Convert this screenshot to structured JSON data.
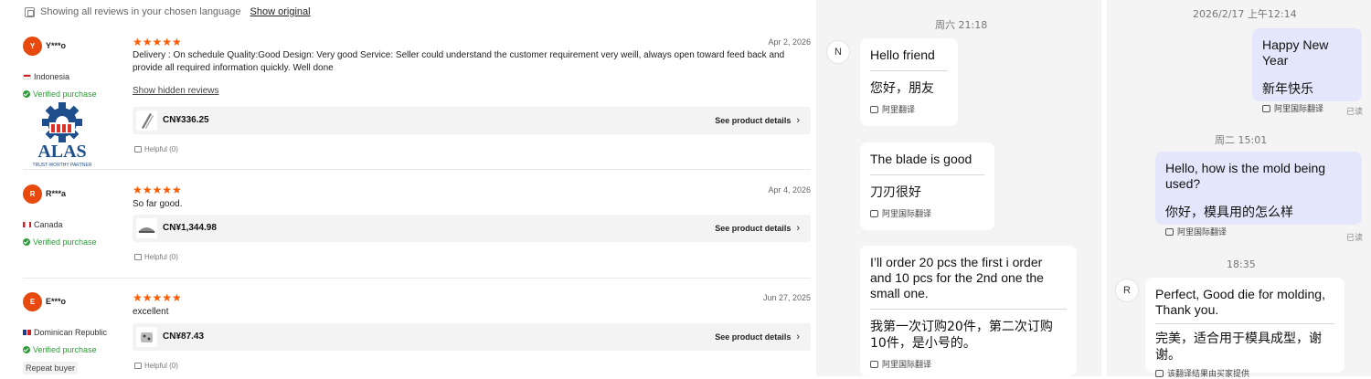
{
  "reviews_panel": {
    "language_note": "Showing all reviews in your chosen language",
    "show_original": "Show original",
    "hidden_reviews_link": "Show hidden reviews",
    "see_details": "See product details",
    "logo": {
      "name": "ALAS",
      "tagline": "TRUST-WORTHY PARTNER"
    },
    "reviews": [
      {
        "initial": "Y",
        "user": "Y***o",
        "country": "Indonesia",
        "verified": "Verified purchase",
        "stars": "★★★★★",
        "date": "Apr 2, 2026",
        "text": "Delivery : On schedule Quality:Good Design: Very good Service: Seller could understand the customer requirement very weill, always open toward feed back and provide all required information quickly. Well done",
        "price": "CN¥336.25",
        "helpful": "Helpful (0)"
      },
      {
        "initial": "R",
        "user": "R***a",
        "country": "Canada",
        "verified": "Verified purchase",
        "stars": "★★★★★",
        "date": "Apr 4, 2026",
        "text": "So far good.",
        "price": "CN¥1,344.98",
        "helpful": "Helpful (0)"
      },
      {
        "initial": "E",
        "user": "E***o",
        "country": "Dominican Republic",
        "verified": "Verified purchase",
        "badge": "Repeat buyer",
        "stars": "★★★★★",
        "date": "Jun 27, 2025",
        "text": "excellent",
        "price": "CN¥87.43",
        "helpful": "Helpful (0)"
      }
    ]
  },
  "chat_left": {
    "time": "周六 21:18",
    "avatar": "N",
    "messages": [
      {
        "orig": "Hello friend",
        "trans": "您好，朋友",
        "tag": "阿里翻译"
      },
      {
        "orig": "The blade is good",
        "trans": "刀刃很好",
        "tag": "阿里国际翻译"
      },
      {
        "orig": "I’ll order 20 pcs the first i order and 10 pcs for the 2nd one the small one.",
        "trans": "我第一次订购20件，第二次订购10件，是小号的。",
        "tag": "阿里国际翻译"
      }
    ]
  },
  "chat_right": {
    "time1": "2026/2/17 上午12:14",
    "msg1": {
      "orig": "Happy New Year",
      "trans": "新年快乐",
      "tag": "阿里国际翻译",
      "read": "已读"
    },
    "time2": "周二 15:01",
    "msg2": {
      "orig": "Hello, how is the mold being used?",
      "trans": "你好，模具用的怎么样",
      "tag": "阿里国际翻译",
      "read": "已读"
    },
    "time3": "18:35",
    "avatar": "R",
    "msg3": {
      "orig": "Perfect, Good die for molding, Thank you.",
      "trans": "完美，适合用于模具成型，谢谢。",
      "tag": "该翻译结果由买家提供"
    }
  },
  "colors": {
    "accent": "#ff5a00",
    "avatar": "#e8490f",
    "verified": "#2e9b3a",
    "out_bubble": "#e4e6fb",
    "logo_blue": "#1f4e8c",
    "logo_red": "#d9322b"
  }
}
